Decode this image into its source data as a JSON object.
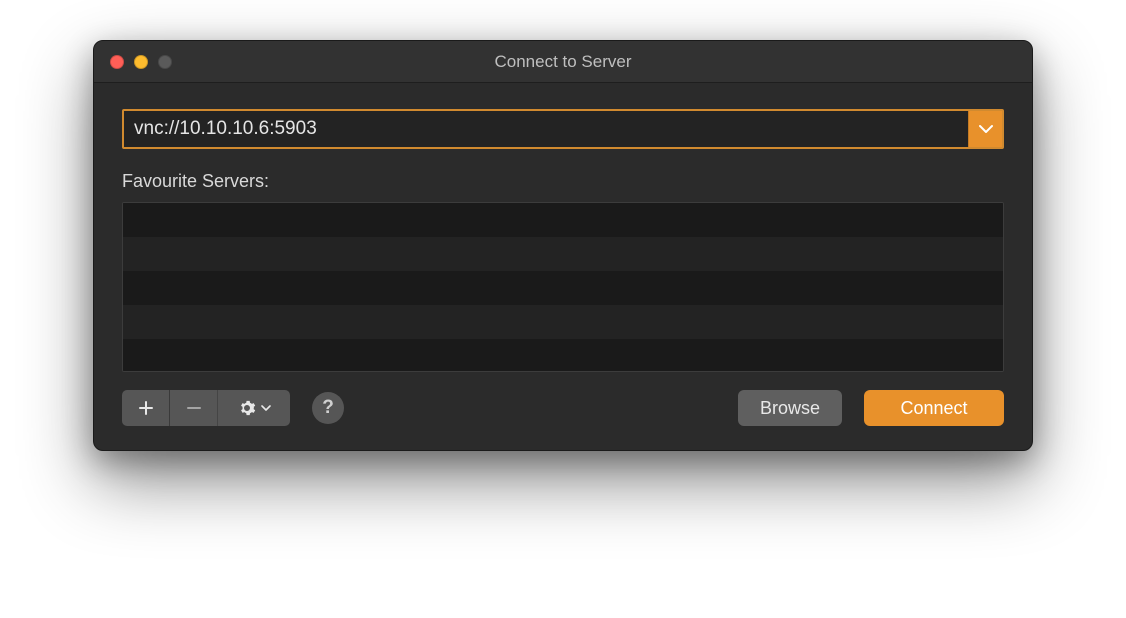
{
  "window": {
    "title": "Connect to Server"
  },
  "address": {
    "value": "vnc://10.10.10.6:5903"
  },
  "favourites": {
    "label": "Favourite Servers:",
    "items": []
  },
  "buttons": {
    "browse": "Browse",
    "connect": "Connect",
    "help": "?"
  },
  "colors": {
    "accent": "#e8912b",
    "window_bg": "#2b2b2b"
  }
}
